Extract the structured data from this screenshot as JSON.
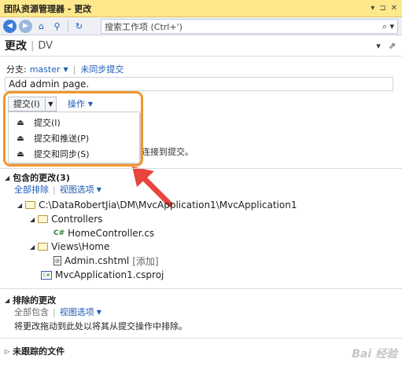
{
  "window": {
    "title": "团队资源管理器 - 更改"
  },
  "toolbar": {
    "search_placeholder": "搜索工作项 (Ctrl+')"
  },
  "header": {
    "title": "更改",
    "subtitle": "DV"
  },
  "branch": {
    "label": "分支:",
    "name": "master",
    "unsynced": "未同步提交"
  },
  "commit_message": "Add admin page.",
  "commit": {
    "button_label": "提交(I)",
    "actions_label": "操作"
  },
  "commit_menu": [
    {
      "label": "提交(I)"
    },
    {
      "label": "提交和推送(P)"
    },
    {
      "label": "提交和同步(S)"
    }
  ],
  "hidden_info_tail": "连接到提交。",
  "included": {
    "title": "包含的更改(3)",
    "exclude_all": "全部排除",
    "view_options": "视图选项",
    "tree": [
      {
        "label": "C:\\DataRobertJia\\DM\\MvcApplication1\\MvcApplication1"
      },
      {
        "label": "Controllers"
      },
      {
        "label": "HomeController.cs"
      },
      {
        "label": "Views\\Home"
      },
      {
        "label": "Admin.cshtml",
        "tag": "[添加]"
      },
      {
        "label": "MvcApplication1.csproj"
      }
    ]
  },
  "excluded": {
    "title": "排除的更改",
    "include_all": "全部包含",
    "view_options": "视图选项",
    "description": "将更改拖动到此处以将其从提交操作中排除。"
  },
  "untracked": {
    "title": "未跟踪的文件"
  },
  "watermark": "Bai 经验",
  "colors": {
    "titlebar": "#ffe88c",
    "highlight": "#f0962a",
    "arrow": "#e8453c",
    "link": "#1e5bb8"
  }
}
